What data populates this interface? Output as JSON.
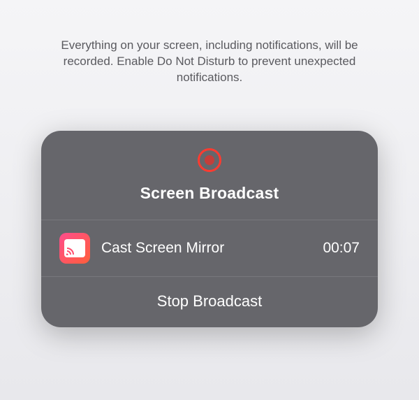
{
  "info_text": "Everything on your screen, including notifications, will be recorded. Enable Do Not Disturb to prevent unexpected notifications.",
  "modal": {
    "title": "Screen Broadcast",
    "app": {
      "name": "Cast Screen Mirror",
      "timer": "00:07"
    },
    "stop_label": "Stop Broadcast"
  }
}
